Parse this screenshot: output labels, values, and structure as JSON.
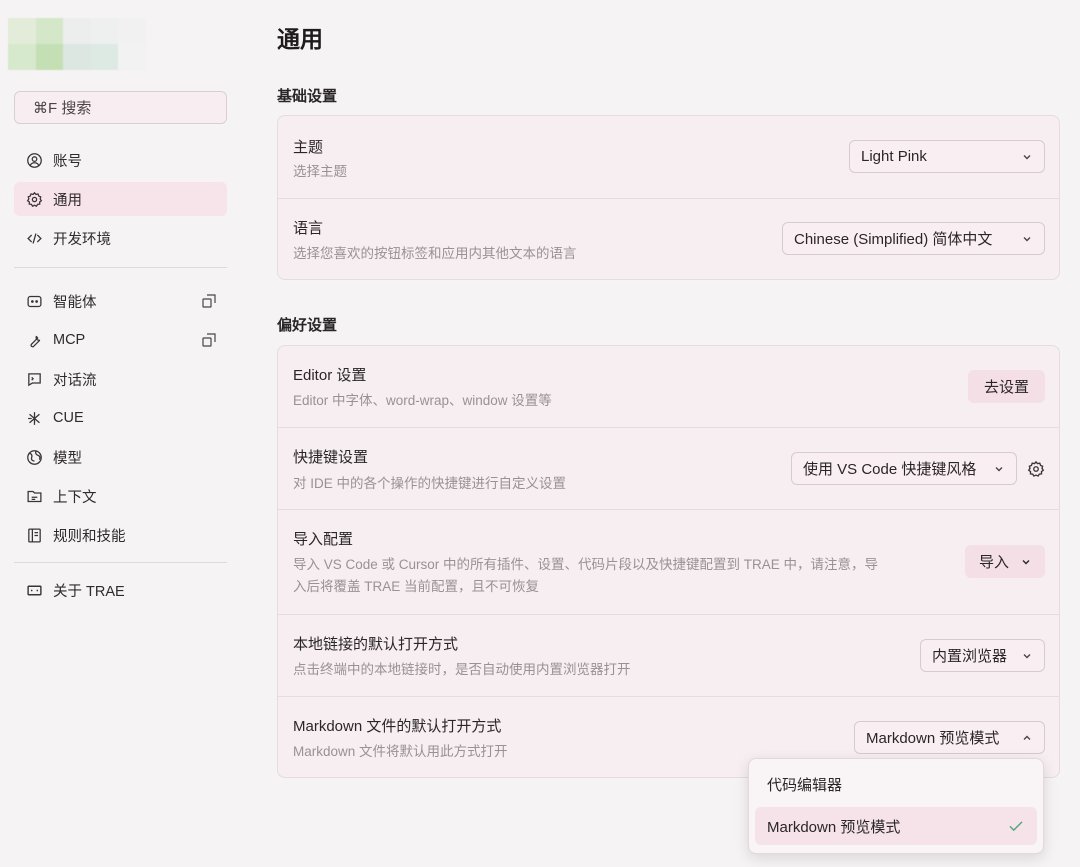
{
  "sidebar": {
    "search_label": "⌘F 搜索",
    "items": [
      {
        "label": "账号",
        "icon": "user-circle-icon",
        "active": false
      },
      {
        "label": "通用",
        "icon": "gear-icon",
        "active": true
      },
      {
        "label": "开发环境",
        "icon": "code-icon",
        "active": false
      },
      {
        "label": "智能体",
        "icon": "agent-icon",
        "active": false,
        "external": true
      },
      {
        "label": "MCP",
        "icon": "wrench-icon",
        "active": false,
        "external": true
      },
      {
        "label": "对话流",
        "icon": "terminal-icon",
        "active": false
      },
      {
        "label": "CUE",
        "icon": "cue-icon",
        "active": false
      },
      {
        "label": "模型",
        "icon": "globe-icon",
        "active": false
      },
      {
        "label": "上下文",
        "icon": "folder-icon",
        "active": false
      },
      {
        "label": "规则和技能",
        "icon": "book-icon",
        "active": false
      },
      {
        "label": "关于 TRAE",
        "icon": "trae-icon",
        "active": false
      }
    ]
  },
  "main": {
    "title": "通用",
    "basic_section": {
      "title": "基础设置",
      "theme": {
        "label": "主题",
        "desc": "选择主题",
        "value": "Light Pink"
      },
      "language": {
        "label": "语言",
        "desc": "选择您喜欢的按钮标签和应用内其他文本的语言",
        "value": "Chinese (Simplified) 简体中文"
      }
    },
    "pref_section": {
      "title": "偏好设置",
      "editor": {
        "label": "Editor 设置",
        "desc": "Editor 中字体、word-wrap、window 设置等",
        "button": "去设置"
      },
      "shortcut": {
        "label": "快捷键设置",
        "desc": "对 IDE 中的各个操作的快捷键进行自定义设置",
        "value": "使用 VS Code 快捷键风格"
      },
      "import": {
        "label": "导入配置",
        "desc_line1": "导入 VS Code 或 Cursor 中的所有插件、设置、代码片段以及快捷键配置到 TRAE 中，请注意，导",
        "desc_line2": "入后将覆盖 TRAE 当前配置，且不可恢复",
        "button": "导入"
      },
      "local_link": {
        "label": "本地链接的默认打开方式",
        "desc": "点击终端中的本地链接时，是否自动使用内置浏览器打开",
        "value": "内置浏览器"
      },
      "markdown": {
        "label": "Markdown 文件的默认打开方式",
        "desc": "Markdown 文件将默认用此方式打开",
        "value": "Markdown 预览模式"
      }
    }
  },
  "dropdown": {
    "options": [
      "代码编辑器",
      "Markdown 预览模式"
    ],
    "selected_index": 1
  },
  "colors": {
    "accent_bg": "#f7e3ea",
    "check": "#4aa77a"
  }
}
